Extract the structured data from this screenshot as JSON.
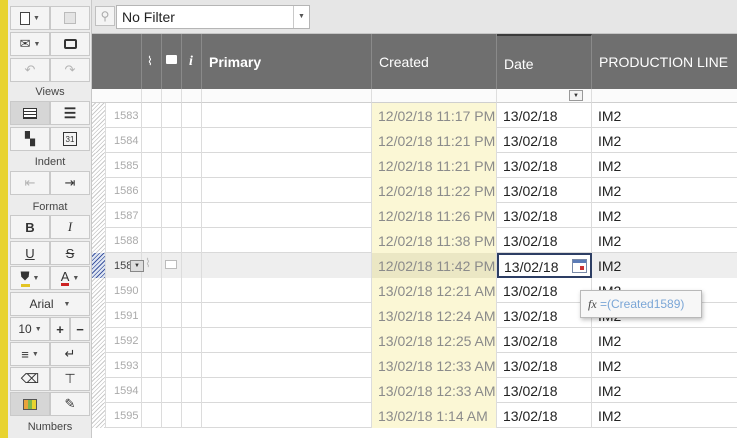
{
  "filter": {
    "value": "No Filter"
  },
  "toolbar": {
    "views_label": "Views",
    "indent_label": "Indent",
    "format_label": "Format",
    "font_name": "Arial",
    "font_size": "10",
    "numbers_label": "Numbers",
    "bold": "B",
    "italic": "I",
    "underline": "U",
    "strike": "S",
    "text_color": "A",
    "plus": "+",
    "minus": "−"
  },
  "columns": {
    "info": "i",
    "primary": "Primary",
    "created": "Created",
    "date": "Date",
    "production_line": "PRODUCTION LINE"
  },
  "rows": [
    {
      "num": "1583",
      "created": "12/02/18 11:17 PM",
      "date": "13/02/18",
      "line": "IM2"
    },
    {
      "num": "1584",
      "created": "12/02/18 11:21 PM",
      "date": "13/02/18",
      "line": "IM2"
    },
    {
      "num": "1585",
      "created": "12/02/18 11:21 PM",
      "date": "13/02/18",
      "line": "IM2"
    },
    {
      "num": "1586",
      "created": "12/02/18 11:22 PM",
      "date": "13/02/18",
      "line": "IM2"
    },
    {
      "num": "1587",
      "created": "12/02/18 11:26 PM",
      "date": "13/02/18",
      "line": "IM2"
    },
    {
      "num": "1588",
      "created": "12/02/18 11:38 PM",
      "date": "13/02/18",
      "line": "IM2"
    },
    {
      "num": "1589",
      "created": "12/02/18 11:42 PM",
      "date": "13/02/18",
      "line": "IM2"
    },
    {
      "num": "1590",
      "created": "13/02/18 12:21 AM",
      "date": "13/02/18",
      "line": "IM2"
    },
    {
      "num": "1591",
      "created": "13/02/18 12:24 AM",
      "date": "13/02/18",
      "line": "IM2"
    },
    {
      "num": "1592",
      "created": "13/02/18 12:25 AM",
      "date": "13/02/18",
      "line": "IM2"
    },
    {
      "num": "1593",
      "created": "13/02/18 12:33 AM",
      "date": "13/02/18",
      "line": "IM2"
    },
    {
      "num": "1594",
      "created": "13/02/18 12:33 AM",
      "date": "13/02/18",
      "line": "IM2"
    },
    {
      "num": "1595",
      "created": "13/02/18 1:14 AM",
      "date": "13/02/18",
      "line": "IM2"
    }
  ],
  "tooltip": {
    "fx": "fx",
    "formula": "=(Created1589)"
  },
  "colors": {
    "stripe": "#e8d330",
    "header": "#6f6f6f",
    "created_bg": "#fbf7d5",
    "selected_hatch": "#3f56a0"
  }
}
